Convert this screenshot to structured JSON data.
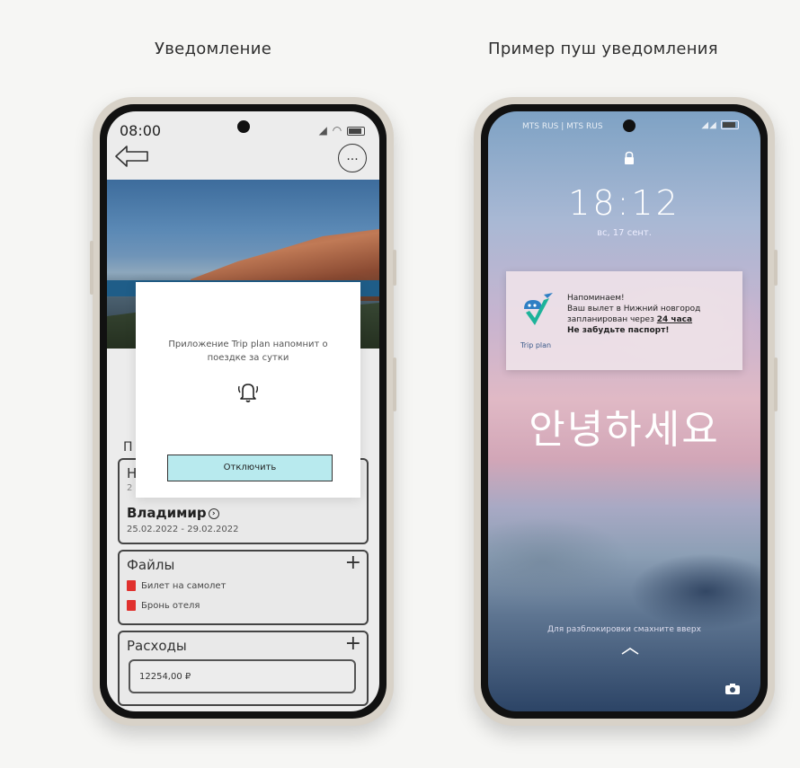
{
  "captions": {
    "left": "Уведомление",
    "right": "Пример пуш уведомления"
  },
  "left_phone": {
    "status_time": "08:00",
    "more_label": "...",
    "section_heading_cut": "П",
    "trip": {
      "title_cut": "Н",
      "subtitle_cut": "2",
      "city": "Владимир",
      "dates": "25.02.2022 - 29.02.2022"
    },
    "files": {
      "title": "Файлы",
      "items": [
        {
          "label": "Билет на самолет",
          "icon": "pdf-icon"
        },
        {
          "label": "Бронь отеля",
          "icon": "pdf-icon"
        }
      ]
    },
    "expenses": {
      "title": "Расходы",
      "amount": "12254,00 ₽"
    },
    "modal": {
      "text": "Приложение Trip plan напомнит о поездке за сутки",
      "icon": "bell-icon",
      "button": "Отключить"
    }
  },
  "right_phone": {
    "carrier": "MTS RUS | MTS RUS",
    "time": "18:12",
    "date": "вс, 17 сент.",
    "notification": {
      "app_name": "Trip plan",
      "line1": "Напоминаем!",
      "line2": "Ваш вылет в Нижний новгород",
      "line3_prefix": "запланирован через ",
      "line3_emph": "24 часа",
      "line4": "Не забудьте паспорт!"
    },
    "greeting": "안녕하세요",
    "swipe_hint": "Для разблокировки смахните вверх"
  },
  "colors": {
    "button_bg": "#b8eaee",
    "pdf_red": "#e0312e",
    "frame": "#d8d2c8"
  }
}
